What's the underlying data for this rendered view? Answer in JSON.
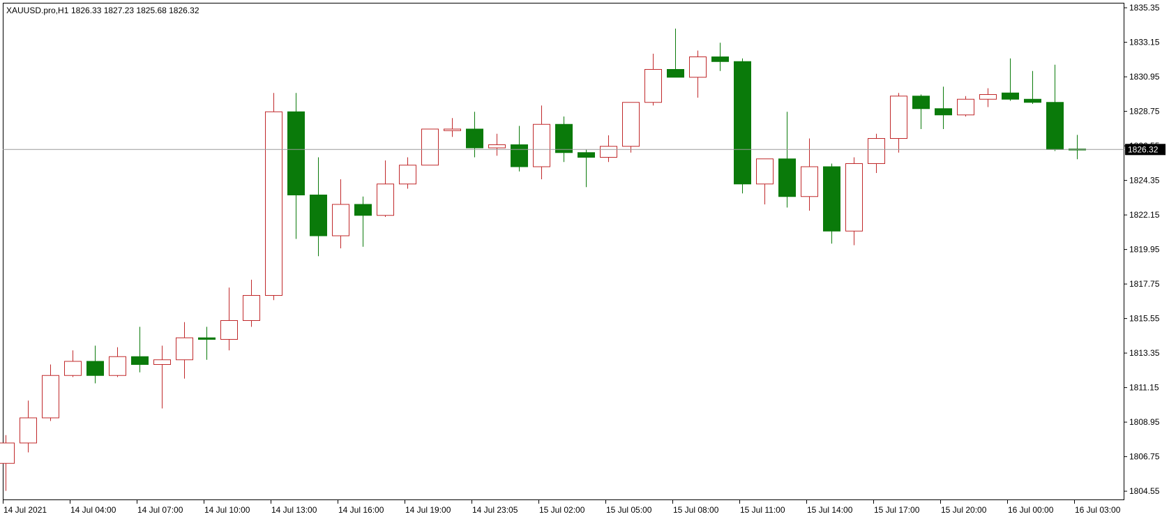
{
  "header": {
    "symbol": "XAUUSD.pro,H1",
    "ohlc": "1826.33 1827.23 1825.68 1826.32"
  },
  "price_tag": "1826.32",
  "colors": {
    "up_border": "#c0282a",
    "up_fill": "#ffffff",
    "down_fill": "#0a7a0a",
    "down_border": "#0a7a0a",
    "current_line": "#9a9a9a",
    "axis": "#000000",
    "price_tag_bg": "#000000"
  },
  "chart_data": {
    "type": "candlestick",
    "symbol": "XAUUSD.pro",
    "timeframe": "H1",
    "ylim": [
      1804.0,
      1835.6
    ],
    "y_ticks": [
      "1835.35",
      "1833.15",
      "1830.95",
      "1828.75",
      "1826.55",
      "1824.35",
      "1822.15",
      "1819.95",
      "1817.75",
      "1815.55",
      "1813.35",
      "1811.15",
      "1808.95",
      "1806.75",
      "1804.55"
    ],
    "x_ticks": [
      {
        "label": "14 Jul 2021",
        "index": 0
      },
      {
        "label": "14 Jul 04:00",
        "index": 3
      },
      {
        "label": "14 Jul 07:00",
        "index": 6
      },
      {
        "label": "14 Jul 10:00",
        "index": 9
      },
      {
        "label": "14 Jul 13:00",
        "index": 12
      },
      {
        "label": "14 Jul 16:00",
        "index": 15
      },
      {
        "label": "14 Jul 19:00",
        "index": 18
      },
      {
        "label": "14 Jul 23:05",
        "index": 21
      },
      {
        "label": "15 Jul 02:00",
        "index": 24
      },
      {
        "label": "15 Jul 05:00",
        "index": 27
      },
      {
        "label": "15 Jul 08:00",
        "index": 30
      },
      {
        "label": "15 Jul 11:00",
        "index": 33
      },
      {
        "label": "15 Jul 14:00",
        "index": 36
      },
      {
        "label": "15 Jul 17:00",
        "index": 39
      },
      {
        "label": "15 Jul 20:00",
        "index": 42
      },
      {
        "label": "16 Jul 00:00",
        "index": 45
      },
      {
        "label": "16 Jul 03:00",
        "index": 48
      }
    ],
    "current_price": 1826.32,
    "candles": [
      {
        "o": 1806.3,
        "h": 1808.1,
        "l": 1804.55,
        "c": 1807.6
      },
      {
        "o": 1807.6,
        "h": 1810.3,
        "l": 1807.0,
        "c": 1809.2
      },
      {
        "o": 1809.2,
        "h": 1812.6,
        "l": 1809.0,
        "c": 1811.9
      },
      {
        "o": 1811.9,
        "h": 1813.5,
        "l": 1811.8,
        "c": 1812.8
      },
      {
        "o": 1812.8,
        "h": 1813.8,
        "l": 1811.4,
        "c": 1811.9
      },
      {
        "o": 1811.9,
        "h": 1813.7,
        "l": 1811.8,
        "c": 1813.1
      },
      {
        "o": 1813.1,
        "h": 1815.0,
        "l": 1812.1,
        "c": 1812.6
      },
      {
        "o": 1812.6,
        "h": 1813.8,
        "l": 1809.8,
        "c": 1812.9
      },
      {
        "o": 1812.9,
        "h": 1815.3,
        "l": 1811.7,
        "c": 1814.3
      },
      {
        "o": 1814.3,
        "h": 1815.0,
        "l": 1812.9,
        "c": 1814.2
      },
      {
        "o": 1814.2,
        "h": 1817.5,
        "l": 1813.5,
        "c": 1815.4
      },
      {
        "o": 1815.4,
        "h": 1818.0,
        "l": 1815.0,
        "c": 1817.0
      },
      {
        "o": 1817.0,
        "h": 1829.9,
        "l": 1816.7,
        "c": 1828.7
      },
      {
        "o": 1828.7,
        "h": 1829.9,
        "l": 1820.6,
        "c": 1823.4
      },
      {
        "o": 1823.4,
        "h": 1825.8,
        "l": 1819.5,
        "c": 1820.8
      },
      {
        "o": 1820.8,
        "h": 1824.4,
        "l": 1820.0,
        "c": 1822.8
      },
      {
        "o": 1822.8,
        "h": 1823.3,
        "l": 1820.1,
        "c": 1822.1
      },
      {
        "o": 1822.1,
        "h": 1825.6,
        "l": 1822.0,
        "c": 1824.1
      },
      {
        "o": 1824.1,
        "h": 1825.8,
        "l": 1823.8,
        "c": 1825.3
      },
      {
        "o": 1825.3,
        "h": 1827.6,
        "l": 1825.3,
        "c": 1827.6
      },
      {
        "o": 1827.5,
        "h": 1828.3,
        "l": 1827.1,
        "c": 1827.6
      },
      {
        "o": 1827.6,
        "h": 1828.7,
        "l": 1825.8,
        "c": 1826.4
      },
      {
        "o": 1826.4,
        "h": 1827.3,
        "l": 1825.9,
        "c": 1826.6
      },
      {
        "o": 1826.6,
        "h": 1827.8,
        "l": 1824.9,
        "c": 1825.2
      },
      {
        "o": 1825.2,
        "h": 1829.1,
        "l": 1824.4,
        "c": 1827.9
      },
      {
        "o": 1827.9,
        "h": 1828.4,
        "l": 1825.5,
        "c": 1826.1
      },
      {
        "o": 1826.1,
        "h": 1826.3,
        "l": 1823.9,
        "c": 1825.8
      },
      {
        "o": 1825.8,
        "h": 1827.2,
        "l": 1825.5,
        "c": 1826.5
      },
      {
        "o": 1826.5,
        "h": 1827.3,
        "l": 1826.1,
        "c": 1829.3
      },
      {
        "o": 1829.3,
        "h": 1832.4,
        "l": 1829.1,
        "c": 1831.4
      },
      {
        "o": 1831.4,
        "h": 1834.0,
        "l": 1830.9,
        "c": 1830.9
      },
      {
        "o": 1830.9,
        "h": 1832.6,
        "l": 1829.6,
        "c": 1832.2
      },
      {
        "o": 1832.2,
        "h": 1833.1,
        "l": 1831.3,
        "c": 1831.9
      },
      {
        "o": 1831.9,
        "h": 1832.1,
        "l": 1823.5,
        "c": 1824.1
      },
      {
        "o": 1824.1,
        "h": 1825.5,
        "l": 1822.8,
        "c": 1825.7
      },
      {
        "o": 1825.7,
        "h": 1828.7,
        "l": 1822.6,
        "c": 1823.3
      },
      {
        "o": 1823.3,
        "h": 1827.0,
        "l": 1822.4,
        "c": 1825.2
      },
      {
        "o": 1825.2,
        "h": 1825.4,
        "l": 1820.3,
        "c": 1821.1
      },
      {
        "o": 1821.1,
        "h": 1825.8,
        "l": 1820.2,
        "c": 1825.4
      },
      {
        "o": 1825.4,
        "h": 1827.3,
        "l": 1824.8,
        "c": 1827.0
      },
      {
        "o": 1827.0,
        "h": 1829.9,
        "l": 1826.1,
        "c": 1829.7
      },
      {
        "o": 1829.7,
        "h": 1829.8,
        "l": 1827.6,
        "c": 1828.9
      },
      {
        "o": 1828.9,
        "h": 1830.3,
        "l": 1827.6,
        "c": 1828.5
      },
      {
        "o": 1828.5,
        "h": 1829.7,
        "l": 1828.4,
        "c": 1829.5
      },
      {
        "o": 1829.5,
        "h": 1830.2,
        "l": 1829.0,
        "c": 1829.8
      },
      {
        "o": 1829.9,
        "h": 1832.1,
        "l": 1829.4,
        "c": 1829.5
      },
      {
        "o": 1829.5,
        "h": 1831.3,
        "l": 1829.2,
        "c": 1829.3
      },
      {
        "o": 1829.3,
        "h": 1831.7,
        "l": 1826.2,
        "c": 1826.3
      },
      {
        "o": 1826.33,
        "h": 1827.23,
        "l": 1825.68,
        "c": 1826.32
      }
    ]
  }
}
